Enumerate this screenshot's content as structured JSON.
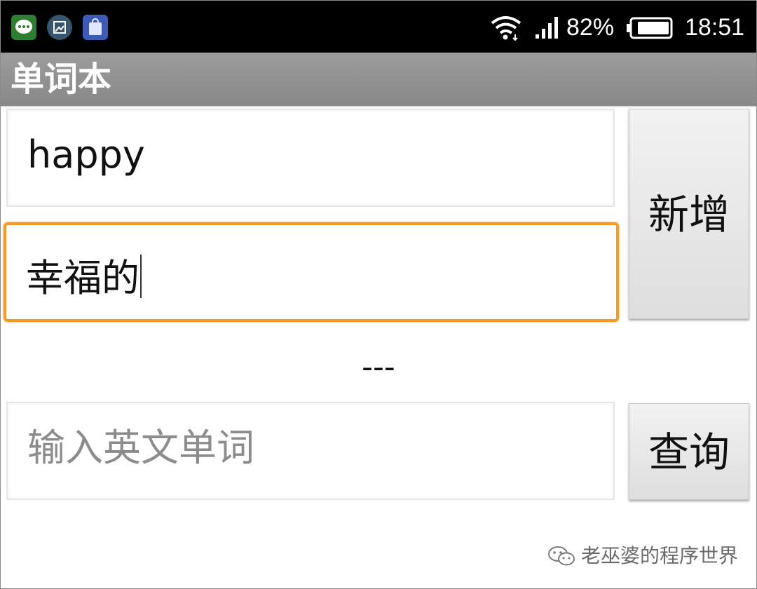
{
  "status_bar": {
    "notification_icons": [
      "message-icon",
      "gallery-icon",
      "store-icon"
    ],
    "battery_percent": "82%",
    "time": "18:51"
  },
  "app": {
    "title": "单词本"
  },
  "form": {
    "english_value": "happy",
    "chinese_value": "幸福的",
    "add_label": "新增",
    "result_text": "---",
    "query_placeholder": "输入英文单词",
    "query_label": "查询"
  },
  "watermark": {
    "text": "老巫婆的程序世界"
  },
  "colors": {
    "focus_border": "#f39a26",
    "action_bar": "#909090",
    "status_bar": "#000000"
  }
}
